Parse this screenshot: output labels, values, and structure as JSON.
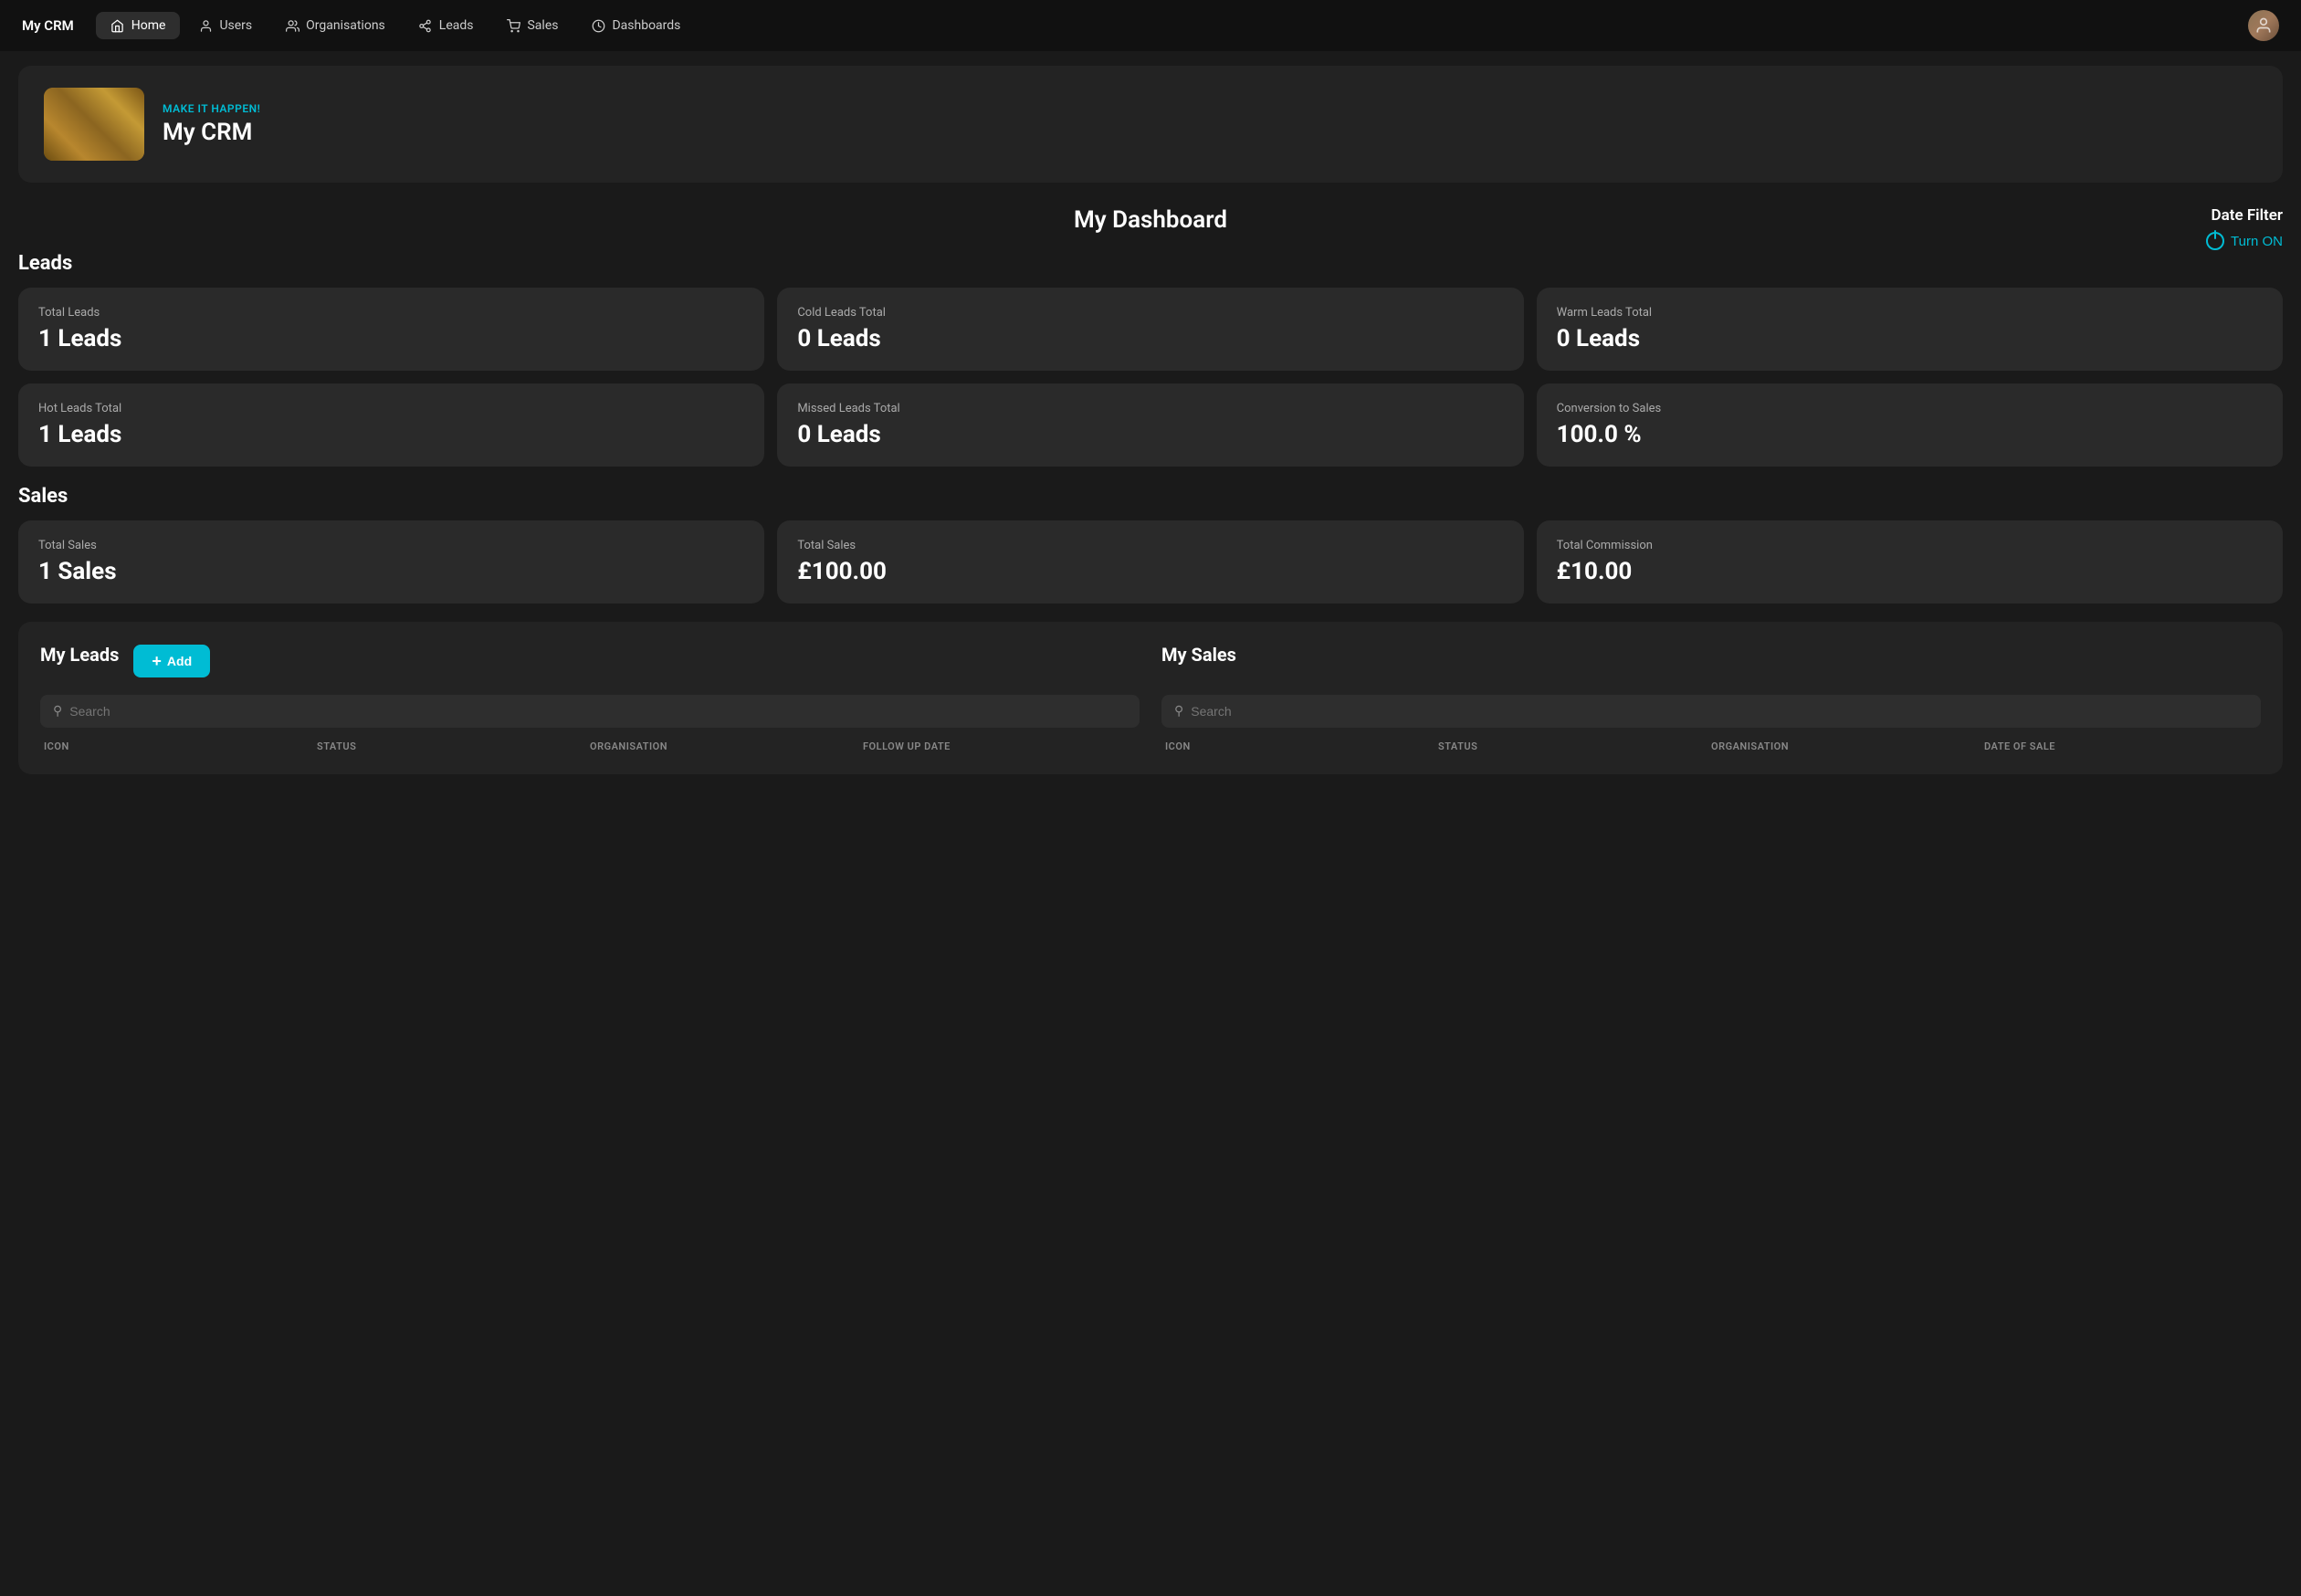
{
  "app": {
    "brand": "My CRM"
  },
  "nav": {
    "links": [
      {
        "id": "home",
        "label": "Home",
        "active": true,
        "icon": "home"
      },
      {
        "id": "users",
        "label": "Users",
        "active": false,
        "icon": "user"
      },
      {
        "id": "organisations",
        "label": "Organisations",
        "active": false,
        "icon": "org"
      },
      {
        "id": "leads",
        "label": "Leads",
        "active": false,
        "icon": "leads"
      },
      {
        "id": "sales",
        "label": "Sales",
        "active": false,
        "icon": "sales"
      },
      {
        "id": "dashboards",
        "label": "Dashboards",
        "active": false,
        "icon": "dashboard"
      }
    ]
  },
  "hero": {
    "tagline": "MAKE IT HAPPEN!",
    "title": "My CRM"
  },
  "dashboard": {
    "title": "My Dashboard",
    "date_filter": {
      "label": "Date Filter",
      "turn_on": "Turn ON"
    }
  },
  "leads_section": {
    "label": "Leads",
    "cards": [
      {
        "label": "Total Leads",
        "value": "1 Leads"
      },
      {
        "label": "Cold Leads Total",
        "value": "0 Leads"
      },
      {
        "label": "Warm Leads Total",
        "value": "0 Leads"
      },
      {
        "label": "Hot Leads Total",
        "value": "1 Leads"
      },
      {
        "label": "Missed Leads Total",
        "value": "0 Leads"
      },
      {
        "label": "Conversion to Sales",
        "value": "100.0 %"
      }
    ]
  },
  "sales_section": {
    "label": "Sales",
    "cards": [
      {
        "label": "Total Sales",
        "value": "1 Sales"
      },
      {
        "label": "Total Sales",
        "value": "£100.00"
      },
      {
        "label": "Total  Commission",
        "value": "£10.00"
      }
    ]
  },
  "my_leads": {
    "title": "My Leads",
    "add_button": "Add",
    "search_placeholder": "Search",
    "columns": [
      "ICON",
      "STATUS",
      "ORGANISATION",
      "FOLLOW UP DATE"
    ]
  },
  "my_sales": {
    "title": "My Sales",
    "search_placeholder": "Search",
    "columns": [
      "ICON",
      "STATUS",
      "ORGANISATION",
      "DATE OF SALE"
    ]
  }
}
